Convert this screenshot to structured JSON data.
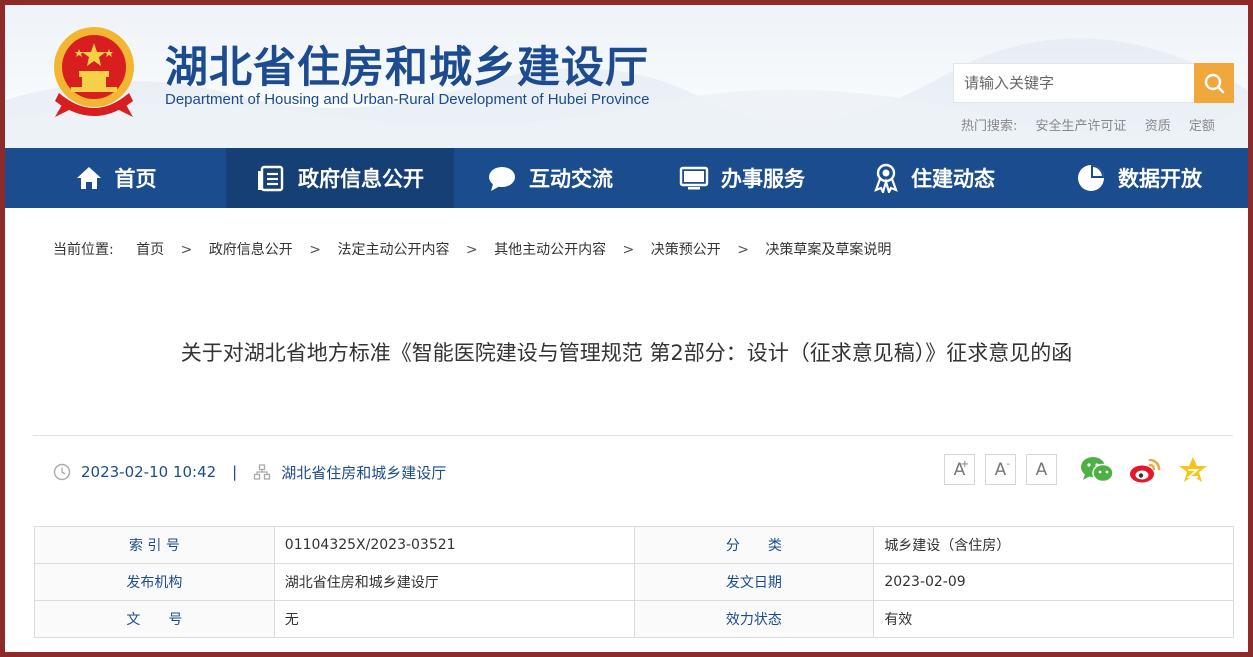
{
  "header": {
    "title": "湖北省住房和城乡建设厅",
    "subtitle": "Department of Housing and Urban-Rural Development of Hubei Province",
    "search_placeholder": "请输入关键字",
    "hot_label": "热门搜索:",
    "hot_keywords": [
      "安全生产许可证",
      "资质",
      "定额"
    ]
  },
  "nav": {
    "items": [
      {
        "label": "首页",
        "icon": "home-icon"
      },
      {
        "label": "政府信息公开",
        "icon": "document-list-icon"
      },
      {
        "label": "互动交流",
        "icon": "chat-bubble-icon"
      },
      {
        "label": "办事服务",
        "icon": "monitor-icon"
      },
      {
        "label": "住建动态",
        "icon": "award-icon"
      },
      {
        "label": "数据开放",
        "icon": "pie-chart-icon"
      }
    ],
    "active_index": 1
  },
  "breadcrumb": {
    "lead": "当前位置:",
    "items": [
      "首页",
      "政府信息公开",
      "法定主动公开内容",
      "其他主动公开内容",
      "决策预公开",
      "决策草案及草案说明"
    ],
    "separator": ">"
  },
  "article": {
    "title": "关于对湖北省地方标准《智能医院建设与管理规范 第2部分：设计（征求意见稿）》征求意见的函",
    "datetime": "2023-02-10 10:42",
    "meta_separator": "|",
    "source": "湖北省住房和城乡建设厅"
  },
  "font_tools": {
    "increase": "A",
    "increase_mark": "+",
    "decrease": "A",
    "decrease_mark": "-",
    "reset": "A"
  },
  "share_icons": [
    "wechat-icon",
    "weibo-icon",
    "qzone-star-icon"
  ],
  "info_table": {
    "rows": [
      {
        "k1": "索 引 号",
        "v1": "01104325X/2023-03521",
        "k2": "分　　类",
        "v2": "城乡建设（含住房）"
      },
      {
        "k1": "发布机构",
        "v1": "湖北省住房和城乡建设厅",
        "k2": "发文日期",
        "v2": "2023-02-09"
      },
      {
        "k1": "文　　号",
        "v1": "无",
        "k2": "效力状态",
        "v2": "有效"
      }
    ]
  },
  "colors": {
    "brand_blue": "#1b4d8e",
    "nav_active": "#163f76",
    "search_button": "#f0a83c",
    "frame": "#8e2a2a"
  }
}
